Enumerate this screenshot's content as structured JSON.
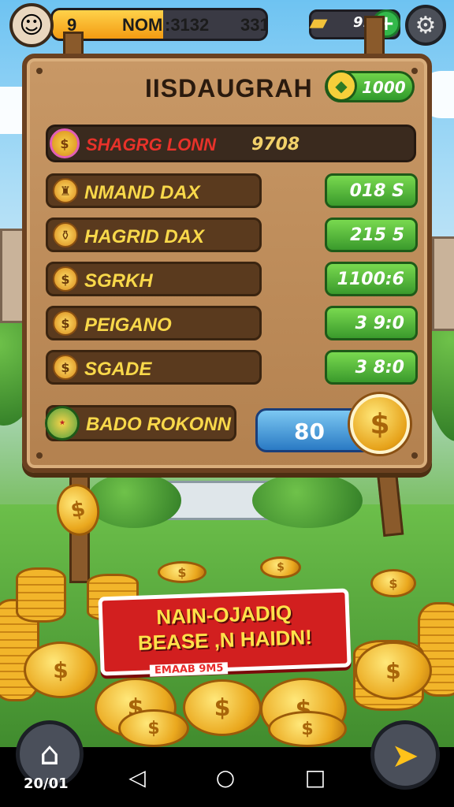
{
  "hud": {
    "level": "9",
    "player_label": "NOM",
    "xp_text": ":3132",
    "xp_extra": "331",
    "xp_progress": 0.52,
    "gems": "91"
  },
  "board": {
    "title": "IISDAUGRAH",
    "balance": "1000",
    "featured": {
      "label": "SHAGRG LONN",
      "value": "9708"
    },
    "items": [
      {
        "label": "NMAND DAX",
        "price": "018 S"
      },
      {
        "label": "HAGRID DAX",
        "price": "215 5"
      },
      {
        "label": "SGRKH",
        "price": "1100:6"
      },
      {
        "label": "PEIGANO",
        "price": "3 9:0"
      },
      {
        "label": "SGADE",
        "price": "3 8:0"
      }
    ],
    "bottom_label": "BADO ROKONN",
    "collect_value": "80"
  },
  "banner": {
    "line1": "NAIN-OJADIQ",
    "line2": "BEASE ,N HAIDN!",
    "subtext": "EMAAB 9M5"
  },
  "bottom": {
    "home_label": "20/01"
  },
  "icons": {
    "avatar": "avatar-face",
    "gems": "gold-bars-icon",
    "plus": "plus-icon",
    "settings": "gear-icon",
    "home": "home-icon",
    "send": "send-arrow-icon",
    "nav_back": "triangle-back-icon",
    "nav_home": "circle-home-icon",
    "nav_recent": "square-recent-icon"
  },
  "colors": {
    "board": "#c89866",
    "price_button": "#3a9a2c",
    "banner": "#d21f1f",
    "coin": "#eaa81e"
  }
}
